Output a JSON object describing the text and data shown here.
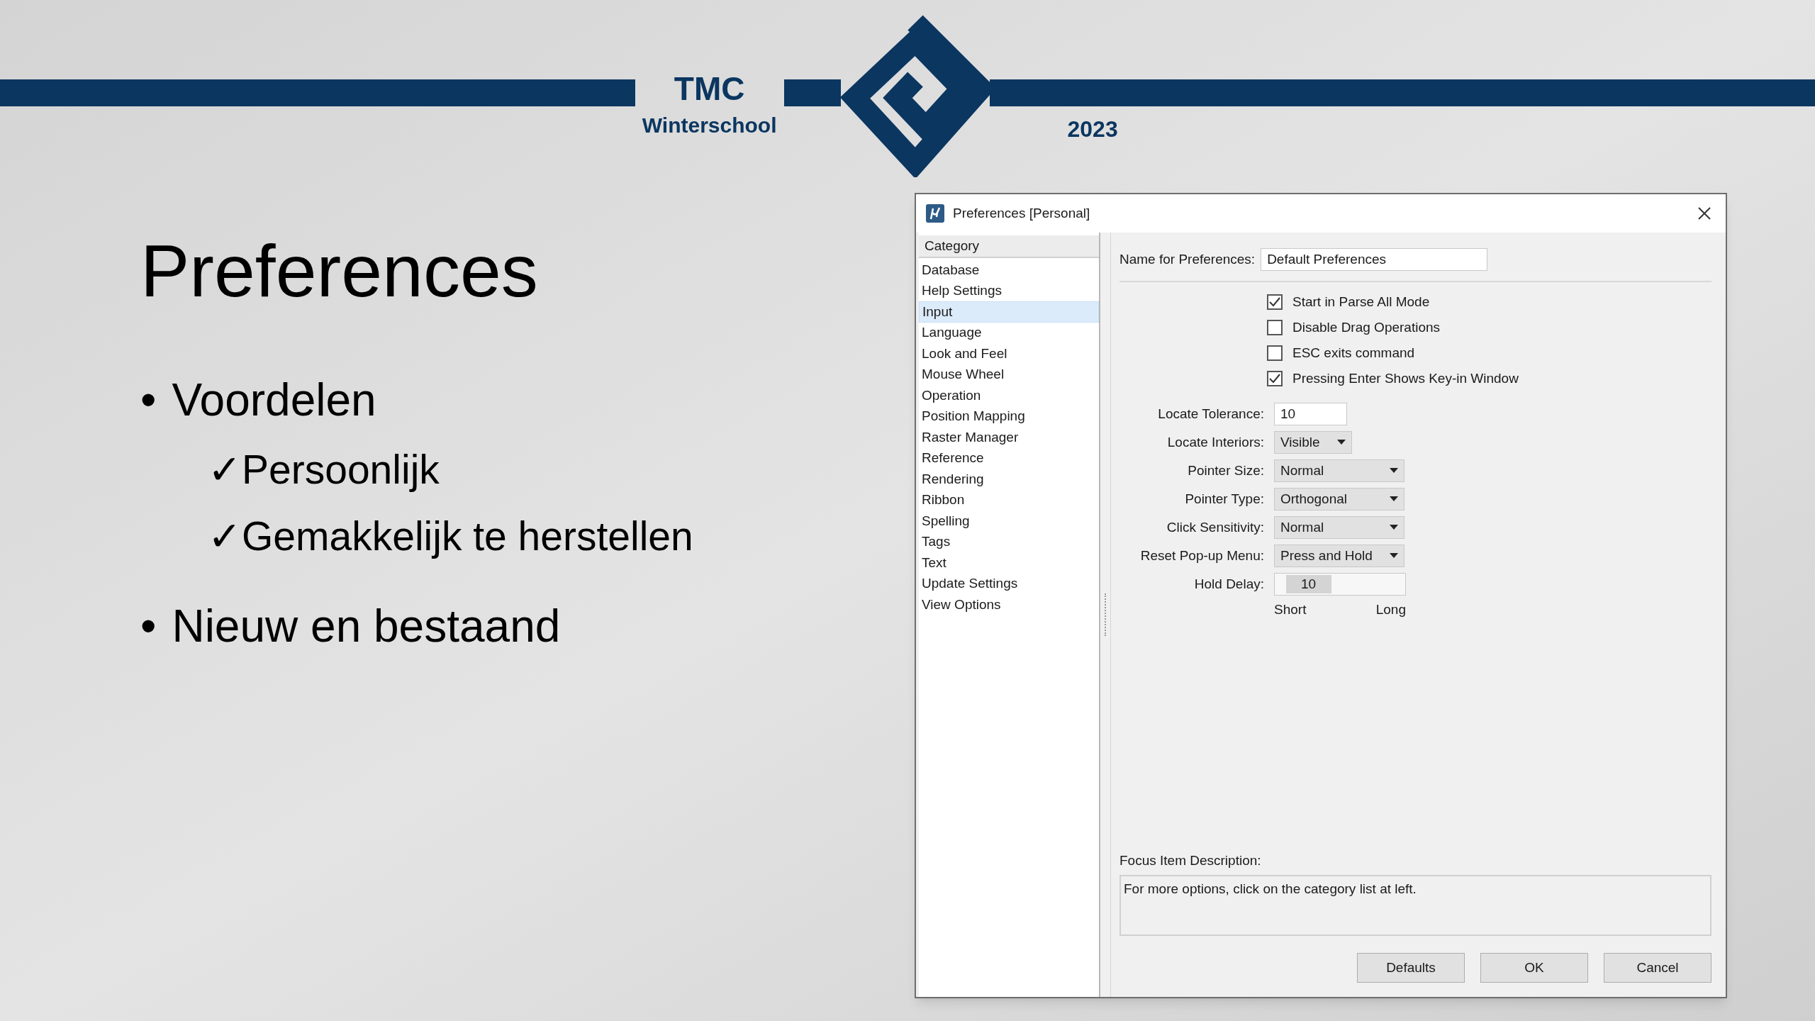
{
  "header": {
    "brand": "TMC",
    "subtitle": "Winterschool",
    "year": "2023"
  },
  "slide": {
    "title": "Preferences",
    "bullets": [
      {
        "marker": "•",
        "text": "Voordelen",
        "children": [
          {
            "marker": "✓",
            "text": "Persoonlijk"
          },
          {
            "marker": "✓",
            "text": "Gemakkelijk te herstellen"
          }
        ]
      },
      {
        "marker": "•",
        "text": "Nieuw en bestaand"
      }
    ]
  },
  "dialog": {
    "title": "Preferences [Personal]",
    "category": {
      "header": "Category",
      "items": [
        {
          "label": "Database",
          "selected": false
        },
        {
          "label": "Help Settings",
          "selected": false
        },
        {
          "label": "Input",
          "selected": true
        },
        {
          "label": "Language",
          "selected": false
        },
        {
          "label": "Look and Feel",
          "selected": false
        },
        {
          "label": "Mouse Wheel",
          "selected": false
        },
        {
          "label": "Operation",
          "selected": false
        },
        {
          "label": "Position Mapping",
          "selected": false
        },
        {
          "label": "Raster Manager",
          "selected": false
        },
        {
          "label": "Reference",
          "selected": false
        },
        {
          "label": "Rendering",
          "selected": false
        },
        {
          "label": "Ribbon",
          "selected": false
        },
        {
          "label": "Spelling",
          "selected": false
        },
        {
          "label": "Tags",
          "selected": false
        },
        {
          "label": "Text",
          "selected": false
        },
        {
          "label": "Update Settings",
          "selected": false
        },
        {
          "label": "View Options",
          "selected": false
        }
      ]
    },
    "name_field": {
      "label": "Name for Preferences:",
      "value": "Default Preferences"
    },
    "checkboxes": [
      {
        "label": "Start in Parse All Mode",
        "checked": true
      },
      {
        "label": "Disable Drag Operations",
        "checked": false
      },
      {
        "label": "ESC exits command",
        "checked": false
      },
      {
        "label": "Pressing Enter Shows Key-in Window",
        "checked": true
      }
    ],
    "fields": [
      {
        "kind": "text",
        "label": "Locate Tolerance:",
        "value": "10"
      },
      {
        "kind": "dropdown",
        "label": "Locate Interiors:",
        "value": "Visible"
      },
      {
        "kind": "dropdown",
        "label": "Pointer Size:",
        "value": "Normal"
      },
      {
        "kind": "dropdown",
        "label": "Pointer Type:",
        "value": "Orthogonal"
      },
      {
        "kind": "dropdown",
        "label": "Click Sensitivity:",
        "value": "Normal"
      },
      {
        "kind": "dropdown",
        "label": "Reset Pop-up Menu:",
        "value": "Press and Hold"
      },
      {
        "kind": "slider",
        "label": "Hold Delay:",
        "value": "10",
        "level": 0.13,
        "min_label": "Short",
        "max_label": "Long"
      }
    ],
    "description": {
      "label": "Focus Item Description:",
      "text": "For more options, click on the category list at left."
    },
    "buttons": [
      "Defaults",
      "OK",
      "Cancel"
    ]
  }
}
